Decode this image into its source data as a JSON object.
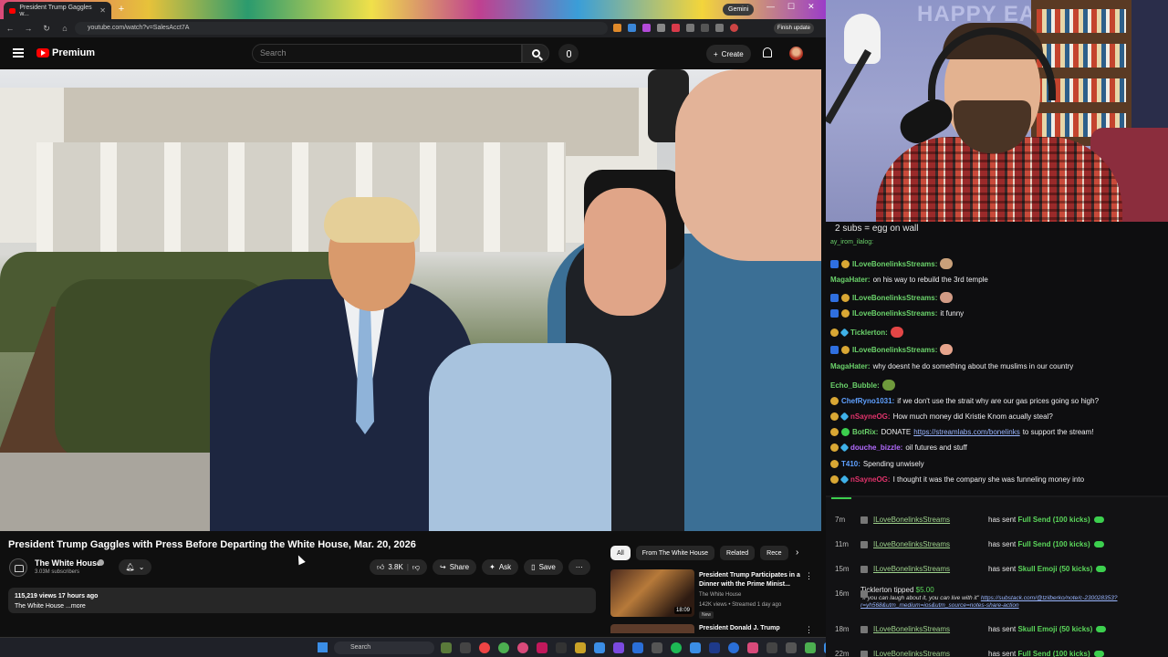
{
  "browser": {
    "tab_title": "President Trump Gaggles w...",
    "url": "youtube.com/watch?v=SalesAcct7A",
    "gemini_label": "Gemini",
    "finish_update_label": "Finish update"
  },
  "youtube": {
    "brand": "Premium",
    "search_placeholder": "Search",
    "create_label": "Create",
    "video": {
      "title": "President Trump Gaggles with Press Before Departing the White House, Mar. 20, 2026",
      "channel": "The White House",
      "subscribers": "3.03M subscribers",
      "likes": "3.8K",
      "share_label": "Share",
      "ask_label": "Ask",
      "save_label": "Save",
      "stats": "115,219 views  17 hours ago",
      "desc_line": "The White House",
      "more_label": "...more"
    },
    "chips": [
      "All",
      "From The White House",
      "Related",
      "Rece"
    ],
    "recommendations": [
      {
        "title": "President Trump Participates in a Dinner with the Prime Minist...",
        "channel": "The White House",
        "meta": "142K views • Streamed 1 day ago",
        "badge": "New",
        "duration": "18:09"
      },
      {
        "title": "President Donald J. Trump"
      }
    ]
  },
  "taskbar": {
    "search_label": "Search",
    "weather_color": "#5a7a3a"
  },
  "webcam": {
    "wall_text": "HAPPY EAS"
  },
  "chat": {
    "pinned": "2 subs = egg on wall",
    "partial_top": "ay_irom_ilalog:",
    "messages": [
      {
        "user": "ILoveBonelinksStreams",
        "color": "#6bd36b",
        "text": "",
        "badges": [
          "kick",
          "gold"
        ],
        "emote": "#c9a07a"
      },
      {
        "user": "MagaHater",
        "color": "#6bd36b",
        "text": "on his way to rebuild the 3rd temple",
        "badges": [],
        "emote": ""
      },
      {
        "user": "ILoveBonelinksStreams",
        "color": "#6bd36b",
        "text": "",
        "badges": [
          "kick",
          "gold"
        ],
        "emote": "#d29b85"
      },
      {
        "user": "ILoveBonelinksStreams",
        "color": "#6bd36b",
        "text": "it funny",
        "badges": [
          "kick",
          "gold"
        ],
        "emote": ""
      },
      {
        "user": "Ticklerton",
        "color": "#6bd36b",
        "text": "",
        "badges": [
          "gold",
          "cyan"
        ],
        "emote": "#e34646"
      },
      {
        "user": "ILoveBonelinksStreams",
        "color": "#6bd36b",
        "text": "",
        "badges": [
          "kick",
          "gold"
        ],
        "emote": "#e7a48c"
      },
      {
        "user": "MagaHater",
        "color": "#6bd36b",
        "text": "why doesnt he do something about the muslims in our country",
        "badges": [],
        "emote": ""
      },
      {
        "user": "Echo_Bubble",
        "color": "#6bd36b",
        "text": "",
        "badges": [],
        "emote": "#6f9a3c"
      },
      {
        "user": "ChefRyno1031",
        "color": "#5fa0ff",
        "text": "if we don't use the strait why are our gas prices going so high?",
        "badges": [
          "gold"
        ],
        "emote": ""
      },
      {
        "user": "nSayneOG",
        "color": "#e0336b",
        "text": "How much money did Kristie Knom acually steal?",
        "badges": [
          "gold",
          "cyan"
        ],
        "emote": ""
      },
      {
        "user": "BotRix",
        "color": "#6bd36b",
        "text": "DONATE",
        "link": "https://streamlabs.com/bonelinks",
        "tail": "to support the stream!",
        "badges": [
          "gold",
          "green"
        ],
        "emote": ""
      },
      {
        "user": "douche_bizzle",
        "color": "#b46bff",
        "text": "oil futures and stuff",
        "badges": [
          "gold",
          "cyan"
        ],
        "emote": ""
      },
      {
        "user": "T410",
        "color": "#5fa0ff",
        "text": "Spending unwisely",
        "badges": [
          "gold"
        ],
        "emote": ""
      },
      {
        "user": "nSayneOG",
        "color": "#e0336b",
        "text": "I thought it was the company she was funneling money into",
        "badges": [
          "gold",
          "cyan"
        ],
        "emote": ""
      }
    ]
  },
  "events": {
    "rows": [
      {
        "time": "7m",
        "who": "ILoveBonelinksStreams",
        "verb": "has sent",
        "item": "Full Send (100 kicks)"
      },
      {
        "time": "11m",
        "who": "ILoveBonelinksStreams",
        "verb": "has sent",
        "item": "Full Send (100 kicks)"
      },
      {
        "time": "15m",
        "who": "ILoveBonelinksStreams",
        "verb": "has sent",
        "item": "Skull Emoji (50 kicks)"
      },
      {
        "time": "16m",
        "who": "",
        "verb": "",
        "item": ""
      },
      {
        "time": "18m",
        "who": "ILoveBonelinksStreams",
        "verb": "has sent",
        "item": "Skull Emoji (50 kicks)"
      },
      {
        "time": "22m",
        "who": "ILoveBonelinksStreams",
        "verb": "has sent",
        "item": "Full Send (100 kicks)"
      }
    ],
    "tip": {
      "who": "Ticklerton tipped",
      "amount": "$5.00",
      "note": "\"If you can laugh about it, you can live with it\"",
      "link": "https://substack.com/@tzilberko/note/c-230028353?r=yh568&utm_medium=ios&utm_source=notes-share-action"
    }
  }
}
